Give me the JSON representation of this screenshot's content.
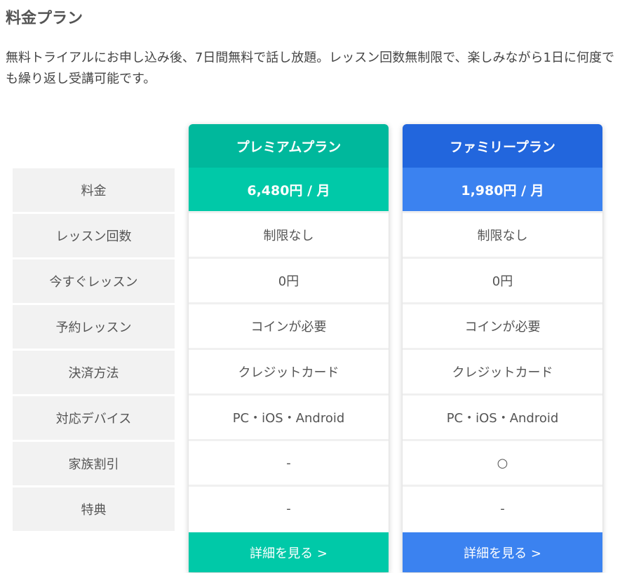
{
  "title": "料金プラン",
  "intro": "無料トライアルにお申し込み後、7日間無料で話し放題。レッスン回数無制限で、楽しみながら1日に何度でも繰り返し受講可能です。",
  "row_labels": [
    "料金",
    "レッスン回数",
    "今すぐレッスン",
    "予約レッスン",
    "決済方法",
    "対応デバイス",
    "家族割引",
    "特典"
  ],
  "plans": [
    {
      "name": "プレミアムプラン",
      "price": "6,480円 / 月",
      "values": [
        "制限なし",
        "0円",
        "コインが必要",
        "クレジットカード",
        "PC・iOS・Android",
        "-",
        "-"
      ],
      "button": "詳細を見る >",
      "colors": {
        "head": "#00b89c",
        "accent": "#00c9a8"
      }
    },
    {
      "name": "ファミリープラン",
      "price": "1,980円 / 月",
      "values": [
        "制限なし",
        "0円",
        "コインが必要",
        "クレジットカード",
        "PC・iOS・Android",
        "○",
        "-"
      ],
      "button": "詳細を見る >",
      "colors": {
        "head": "#2266dd",
        "accent": "#3b82f0"
      }
    }
  ]
}
